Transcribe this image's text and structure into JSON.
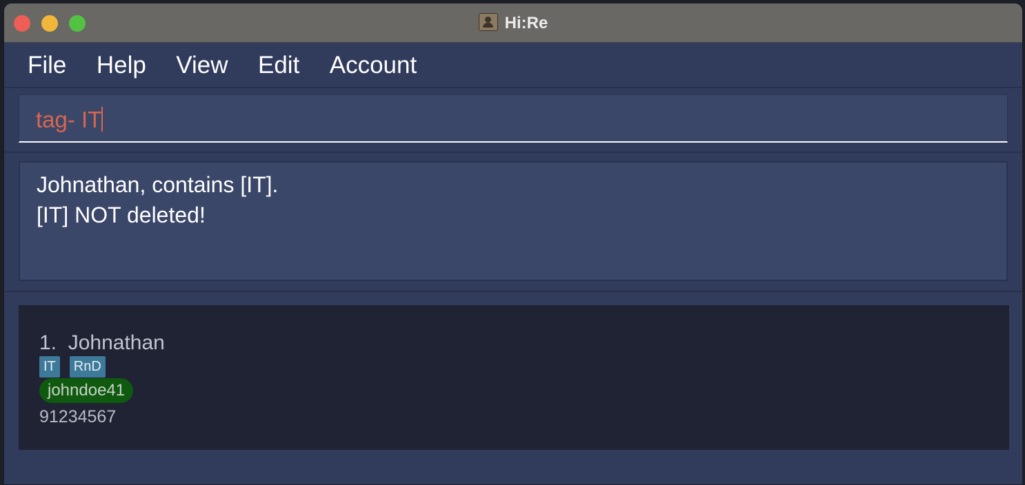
{
  "window": {
    "title": "Hi:Re"
  },
  "menu": [
    "File",
    "Help",
    "View",
    "Edit",
    "Account"
  ],
  "command": {
    "value": "tag- IT"
  },
  "result": {
    "lines": [
      "Johnathan, contains [IT].",
      "[IT] NOT deleted!"
    ]
  },
  "persons": [
    {
      "index": "1.",
      "name": "Johnathan",
      "tags": [
        "IT",
        "RnD"
      ],
      "username": "johndoe41",
      "phone": "91234567"
    }
  ],
  "colors": {
    "accent_command_text": "#d9664e",
    "tag_bg": "#3d7a99",
    "username_bg": "#0f5a0f",
    "window_bg": "#313b5c"
  }
}
